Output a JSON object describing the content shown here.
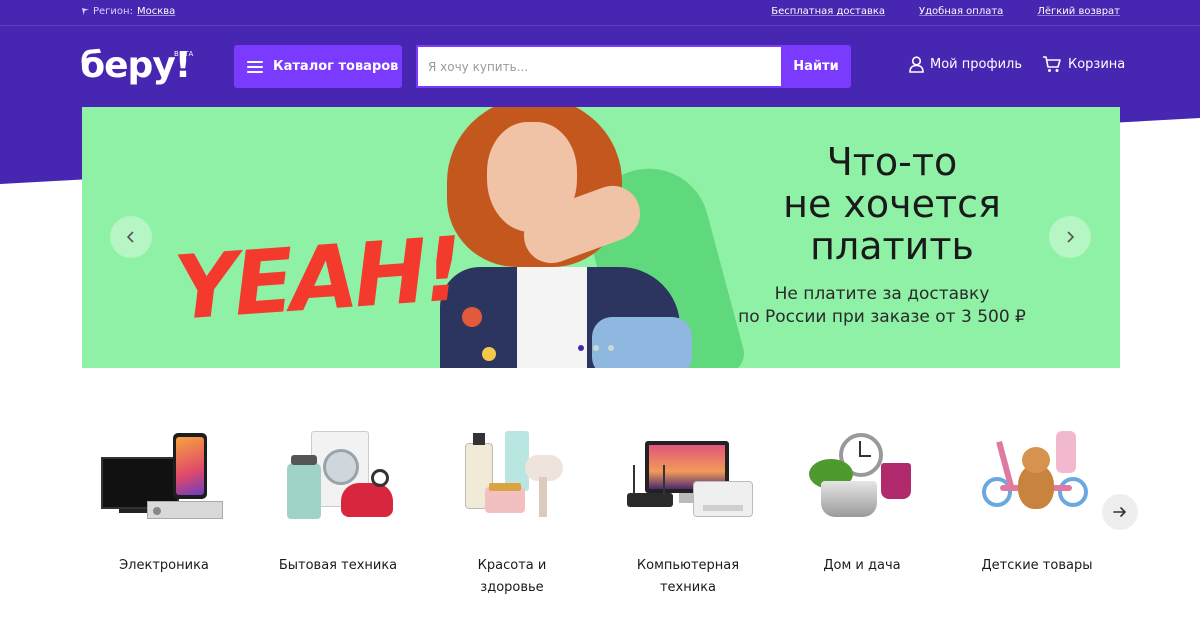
{
  "topbar": {
    "region_prefix": "Регион:",
    "region_city": "Москва",
    "links": [
      "Бесплатная доставка",
      "Удобная оплата",
      "Лёгкий возврат"
    ]
  },
  "header": {
    "logo": "беру!",
    "logo_badge": "BETA",
    "catalog_label": "Каталог товаров",
    "search_placeholder": "Я хочу купить...",
    "search_button": "Найти",
    "profile_label": "Мой профиль",
    "cart_label": "Корзина"
  },
  "banner": {
    "sticker": "YEAH!",
    "title_lines": [
      "Что-то",
      "не хочется",
      "платить"
    ],
    "subtitle_lines": [
      "Не платите за доставку",
      "по России при заказе от 3 500 ₽"
    ],
    "slides_count": 3,
    "active_slide": 1
  },
  "categories": [
    {
      "label_lines": [
        "Электроника"
      ],
      "icon": "electronics-icon"
    },
    {
      "label_lines": [
        "Бытовая техника"
      ],
      "icon": "appliances-icon"
    },
    {
      "label_lines": [
        "Красота и",
        "здоровье"
      ],
      "icon": "beauty-icon"
    },
    {
      "label_lines": [
        "Компьютерная",
        "техника"
      ],
      "icon": "computers-icon"
    },
    {
      "label_lines": [
        "Дом и дача"
      ],
      "icon": "home-icon"
    },
    {
      "label_lines": [
        "Детские товары"
      ],
      "icon": "kids-icon"
    }
  ],
  "colors": {
    "brand_purple": "#4726b2",
    "accent_violet": "#7b3bff",
    "banner_green": "#8ef1a5",
    "sticker_red": "#f33a2d"
  }
}
